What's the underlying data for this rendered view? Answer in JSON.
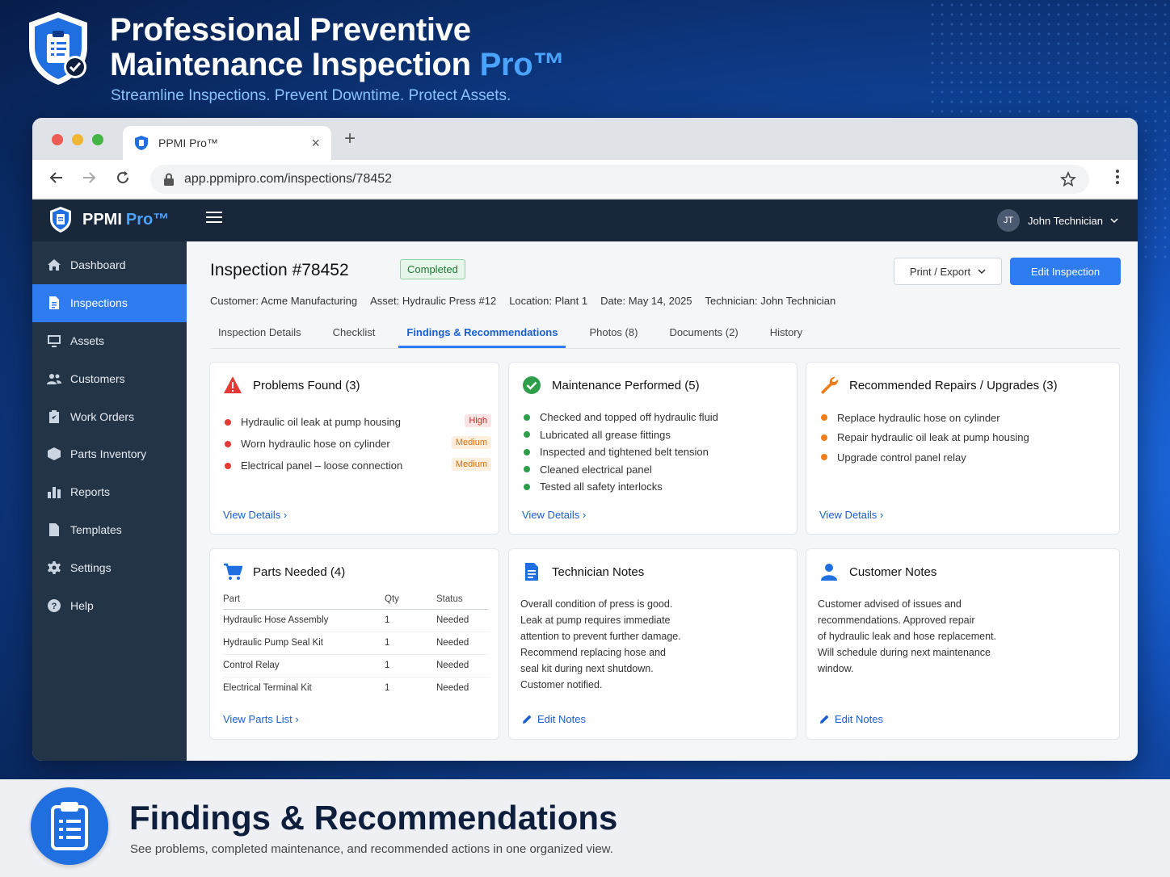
{
  "hero": {
    "title_line1": "Professional Preventive",
    "title_line2": "Maintenance Inspection",
    "title_pro": "Pro™",
    "subtitle": "Streamline Inspections. Prevent Downtime. Protect Assets."
  },
  "browser": {
    "tab_title": "PPMI Pro™",
    "tab_close": "×",
    "new_tab": "+",
    "url": "app.ppmipro.com/inspections/78452"
  },
  "app": {
    "brand": "PPMI",
    "brand_pro": "Pro™",
    "user_initials": "JT",
    "user_name": "John Technician"
  },
  "sidebar": {
    "items": [
      {
        "label": "Dashboard",
        "icon": "home-icon",
        "active": false
      },
      {
        "label": "Inspections",
        "icon": "document-icon",
        "active": true
      },
      {
        "label": "Assets",
        "icon": "monitor-icon",
        "active": false
      },
      {
        "label": "Customers",
        "icon": "users-icon",
        "active": false
      },
      {
        "label": "Work Orders",
        "icon": "clipboard-check-icon",
        "active": false
      },
      {
        "label": "Parts Inventory",
        "icon": "box-icon",
        "active": false
      },
      {
        "label": "Reports",
        "icon": "bar-chart-icon",
        "active": false
      },
      {
        "label": "Templates",
        "icon": "file-icon",
        "active": false
      },
      {
        "label": "Settings",
        "icon": "gear-icon",
        "active": false
      },
      {
        "label": "Help",
        "icon": "help-icon",
        "active": false
      }
    ]
  },
  "inspection": {
    "title": "Inspection #78452",
    "status": "Completed",
    "print_label": "Print / Export",
    "edit_label": "Edit Inspection",
    "customer_label": "Customer:",
    "customer": "Acme Manufacturing",
    "asset_label": "Asset:",
    "asset": "Hydraulic Press #12",
    "location_label": "Location:",
    "location": "Plant 1",
    "date_label": "Date:",
    "date": "May 14, 2025",
    "technician_label": "Technician:",
    "technician": "John Technician"
  },
  "tabs": [
    "Inspection Details",
    "Checklist",
    "Findings & Recommendations",
    "Photos (8)",
    "Documents (2)",
    "History"
  ],
  "problems": {
    "title": "Problems Found (3)",
    "items": [
      {
        "text": "Hydraulic oil leak at pump housing",
        "severity": "High"
      },
      {
        "text": "Worn hydraulic hose on cylinder",
        "severity": "Medium"
      },
      {
        "text": "Electrical panel – loose connection",
        "severity": "Medium"
      }
    ],
    "link": "View Details"
  },
  "maintenance": {
    "title": "Maintenance Performed (5)",
    "items": [
      "Checked and topped off hydraulic fluid",
      "Lubricated all grease fittings",
      "Inspected and tightened belt tension",
      "Cleaned electrical panel",
      "Tested all safety interlocks"
    ],
    "link": "View Details"
  },
  "repairs": {
    "title": "Recommended Repairs / Upgrades (3)",
    "items": [
      "Replace hydraulic hose on cylinder",
      "Repair hydraulic oil leak at pump housing",
      "Upgrade control panel relay"
    ],
    "link": "View Details"
  },
  "parts": {
    "title": "Parts Needed (4)",
    "headers": [
      "Part",
      "Qty",
      "Status"
    ],
    "rows": [
      [
        "Hydraulic Hose Assembly",
        "1",
        "Needed"
      ],
      [
        "Hydraulic Pump Seal Kit",
        "1",
        "Needed"
      ],
      [
        "Control Relay",
        "1",
        "Needed"
      ],
      [
        "Electrical Terminal Kit",
        "1",
        "Needed"
      ]
    ],
    "link": "View Parts List"
  },
  "tech_notes": {
    "title": "Technician Notes",
    "lines": [
      "Overall condition of press is good.",
      "Leak at pump requires immediate",
      "attention to prevent further damage.",
      "Recommend replacing hose and",
      "seal kit during next shutdown.",
      "Customer notified."
    ],
    "link": "Edit Notes"
  },
  "customer_notes": {
    "title": "Customer Notes",
    "lines": [
      "Customer advised of issues and",
      "recommendations. Approved repair",
      "of hydraulic leak and hose replacement.",
      "Will schedule during next maintenance",
      "window."
    ],
    "link": "Edit Notes"
  },
  "banner": {
    "title": "Findings & Recommendations",
    "subtitle": "See problems, completed maintenance, and recommended actions in one organized view."
  },
  "colors": {
    "accent": "#2f7bf0",
    "sidebar": "#243447",
    "danger": "#e53935",
    "success": "#2e9e4a",
    "warning": "#f07d1a"
  }
}
